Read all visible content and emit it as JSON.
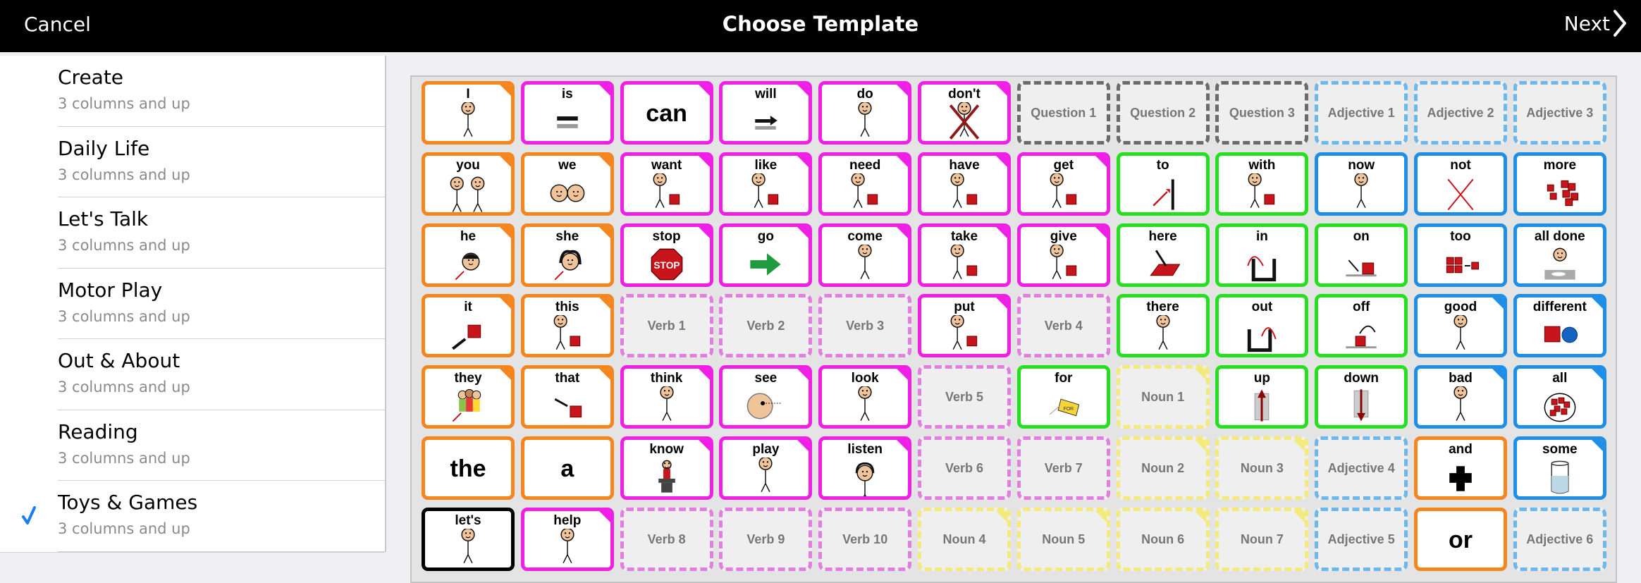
{
  "header": {
    "cancel_label": "Cancel",
    "title": "Choose Template",
    "next_label": "Next"
  },
  "sidebar": {
    "selected_index": 6,
    "items": [
      {
        "title": "Create",
        "subtitle": "3 columns and up"
      },
      {
        "title": "Daily Life",
        "subtitle": "3 columns and up"
      },
      {
        "title": "Let's Talk",
        "subtitle": "3 columns and up"
      },
      {
        "title": "Motor Play",
        "subtitle": "3 columns and up"
      },
      {
        "title": "Out & About",
        "subtitle": "3 columns and up"
      },
      {
        "title": "Reading",
        "subtitle": "3 columns and up"
      },
      {
        "title": "Toys & Games",
        "subtitle": "3 columns and up"
      }
    ]
  },
  "colors": {
    "orange": "#f5851f",
    "pink": "#ef1fe6",
    "green": "#25e01f",
    "blue": "#1e8ee6",
    "black": "#000000",
    "question_placeholder": "#6b6b6b",
    "adjective_placeholder": "#6cb8ec",
    "verb_placeholder": "#e27ee0",
    "noun_placeholder": "#f2ea7a",
    "checkmark": "#1a7ef2"
  },
  "grid": {
    "rows": [
      [
        {
          "label": "I",
          "color": "orange",
          "fold": true,
          "icon": "person-pointing-self-icon"
        },
        {
          "label": "is",
          "color": "pink",
          "fold": true,
          "icon": "equals-icon"
        },
        {
          "label": "can",
          "color": "pink",
          "fold": true,
          "text_only": true
        },
        {
          "label": "will",
          "color": "pink",
          "fold": true,
          "icon": "arrow-equals-icon"
        },
        {
          "label": "do",
          "color": "pink",
          "fold": true,
          "icon": "person-reaching-icon"
        },
        {
          "label": "don't",
          "color": "pink",
          "fold": true,
          "icon": "crossed-person-icon"
        },
        {
          "label": "Question 1",
          "color": "question_placeholder",
          "placeholder": true
        },
        {
          "label": "Question 2",
          "color": "question_placeholder",
          "placeholder": true
        },
        {
          "label": "Question 3",
          "color": "question_placeholder",
          "placeholder": true
        },
        {
          "label": "Adjective 1",
          "color": "adjective_placeholder",
          "placeholder": true
        },
        {
          "label": "Adjective 2",
          "color": "adjective_placeholder",
          "placeholder": true
        },
        {
          "label": "Adjective 3",
          "color": "adjective_placeholder",
          "placeholder": true
        }
      ],
      [
        {
          "label": "you",
          "color": "orange",
          "fold": true,
          "icon": "two-people-pointing-icon"
        },
        {
          "label": "we",
          "color": "orange",
          "fold": true,
          "icon": "two-faces-icon"
        },
        {
          "label": "want",
          "color": "pink",
          "fold": true,
          "icon": "person-reaching-block-icon"
        },
        {
          "label": "like",
          "color": "pink",
          "fold": true,
          "icon": "person-hugging-block-icon"
        },
        {
          "label": "need",
          "color": "pink",
          "fold": true,
          "icon": "hands-block-icon"
        },
        {
          "label": "have",
          "color": "pink",
          "fold": true,
          "icon": "person-holding-block-icon"
        },
        {
          "label": "get",
          "color": "pink",
          "fold": true,
          "icon": "hand-grabbing-block-icon"
        },
        {
          "label": "to",
          "color": "green",
          "fold": false,
          "icon": "arrow-to-line-icon"
        },
        {
          "label": "with",
          "color": "green",
          "fold": false,
          "icon": "block-joining-group-icon"
        },
        {
          "label": "now",
          "color": "blue",
          "fold": false,
          "icon": "person-clock-icon"
        },
        {
          "label": "not",
          "color": "blue",
          "fold": false,
          "icon": "red-x-icon"
        },
        {
          "label": "more",
          "color": "blue",
          "fold": false,
          "icon": "blocks-pile-icon"
        }
      ],
      [
        {
          "label": "he",
          "color": "orange",
          "fold": true,
          "icon": "boy-face-icon"
        },
        {
          "label": "she",
          "color": "orange",
          "fold": true,
          "icon": "girl-face-icon"
        },
        {
          "label": "stop",
          "color": "pink",
          "fold": true,
          "icon": "stop-sign-icon"
        },
        {
          "label": "go",
          "color": "pink",
          "fold": true,
          "icon": "green-arrow-icon"
        },
        {
          "label": "come",
          "color": "pink",
          "fold": true,
          "icon": "person-beckoning-icon"
        },
        {
          "label": "take",
          "color": "pink",
          "fold": true,
          "icon": "person-taking-block-icon"
        },
        {
          "label": "give",
          "color": "pink",
          "fold": true,
          "icon": "people-giving-block-icon"
        },
        {
          "label": "here",
          "color": "green",
          "fold": false,
          "icon": "pointing-at-mat-icon"
        },
        {
          "label": "in",
          "color": "green",
          "fold": false,
          "icon": "arrow-into-box-icon"
        },
        {
          "label": "on",
          "color": "green",
          "fold": false,
          "icon": "arrow-onto-block-icon"
        },
        {
          "label": "too",
          "color": "blue",
          "fold": false,
          "icon": "blocks-adding-icon"
        },
        {
          "label": "all done",
          "color": "blue",
          "fold": false,
          "icon": "person-empty-plate-icon"
        }
      ],
      [
        {
          "label": "it",
          "color": "orange",
          "fold": true,
          "icon": "hand-pointing-block-icon"
        },
        {
          "label": "this",
          "color": "orange",
          "fold": true,
          "icon": "person-pointing-block-icon"
        },
        {
          "label": "Verb 1",
          "color": "verb_placeholder",
          "placeholder": true
        },
        {
          "label": "Verb 2",
          "color": "verb_placeholder",
          "placeholder": true
        },
        {
          "label": "Verb 3",
          "color": "verb_placeholder",
          "placeholder": true
        },
        {
          "label": "put",
          "color": "pink",
          "fold": true,
          "icon": "person-placing-block-icon"
        },
        {
          "label": "Verb 4",
          "color": "verb_placeholder",
          "placeholder": true
        },
        {
          "label": "there",
          "color": "green",
          "fold": false,
          "icon": "person-pointing-sign-icon"
        },
        {
          "label": "out",
          "color": "green",
          "fold": false,
          "icon": "arrow-out-of-box-icon"
        },
        {
          "label": "off",
          "color": "green",
          "fold": false,
          "icon": "arrow-off-block-icon"
        },
        {
          "label": "good",
          "color": "blue",
          "fold": true,
          "icon": "person-thumbs-up-icon"
        },
        {
          "label": "different",
          "color": "blue",
          "fold": true,
          "icon": "square-and-circle-icon"
        }
      ],
      [
        {
          "label": "they",
          "color": "orange",
          "fold": true,
          "icon": "group-of-people-icon"
        },
        {
          "label": "that",
          "color": "orange",
          "fold": true,
          "icon": "hand-pointing-far-block-icon"
        },
        {
          "label": "think",
          "color": "pink",
          "fold": true,
          "icon": "person-thinking-icon"
        },
        {
          "label": "see",
          "color": "pink",
          "fold": true,
          "icon": "eye-looking-icon"
        },
        {
          "label": "look",
          "color": "pink",
          "fold": true,
          "icon": "person-looking-icon"
        },
        {
          "label": "Verb 5",
          "color": "verb_placeholder",
          "placeholder": true
        },
        {
          "label": "for",
          "color": "green",
          "fold": false,
          "icon": "price-tag-icon"
        },
        {
          "label": "Noun 1",
          "color": "noun_placeholder",
          "placeholder": true,
          "fold": true
        },
        {
          "label": "up",
          "color": "green",
          "fold": false,
          "icon": "arrow-up-icon"
        },
        {
          "label": "down",
          "color": "green",
          "fold": false,
          "icon": "arrow-down-icon"
        },
        {
          "label": "bad",
          "color": "blue",
          "fold": true,
          "icon": "person-thumbs-down-icon"
        },
        {
          "label": "all",
          "color": "blue",
          "fold": true,
          "icon": "bag-of-blocks-icon"
        }
      ],
      [
        {
          "label": "the",
          "color": "orange",
          "fold": false,
          "text_only": true
        },
        {
          "label": "a",
          "color": "orange",
          "fold": false,
          "text_only": true
        },
        {
          "label": "know",
          "color": "pink",
          "fold": true,
          "icon": "person-at-desk-icon"
        },
        {
          "label": "play",
          "color": "pink",
          "fold": true,
          "icon": "people-playing-icon"
        },
        {
          "label": "listen",
          "color": "pink",
          "fold": true,
          "icon": "person-headphones-icon"
        },
        {
          "label": "Verb 6",
          "color": "verb_placeholder",
          "placeholder": true
        },
        {
          "label": "Verb 7",
          "color": "verb_placeholder",
          "placeholder": true
        },
        {
          "label": "Noun 2",
          "color": "noun_placeholder",
          "placeholder": true,
          "fold": true
        },
        {
          "label": "Noun 3",
          "color": "noun_placeholder",
          "placeholder": true,
          "fold": true
        },
        {
          "label": "Adjective 4",
          "color": "adjective_placeholder",
          "placeholder": true
        },
        {
          "label": "and",
          "color": "orange",
          "fold": false,
          "icon": "plus-sign-icon"
        },
        {
          "label": "some",
          "color": "blue",
          "fold": true,
          "icon": "glass-of-water-icon"
        }
      ],
      [
        {
          "label": "let's",
          "color": "black",
          "fold": false,
          "icon": "people-together-icon"
        },
        {
          "label": "help",
          "color": "pink",
          "fold": true,
          "icon": "person-helping-icon"
        },
        {
          "label": "Verb 8",
          "color": "verb_placeholder",
          "placeholder": true
        },
        {
          "label": "Verb 9",
          "color": "verb_placeholder",
          "placeholder": true
        },
        {
          "label": "Verb 10",
          "color": "verb_placeholder",
          "placeholder": true
        },
        {
          "label": "Noun 4",
          "color": "noun_placeholder",
          "placeholder": true,
          "fold": true
        },
        {
          "label": "Noun 5",
          "color": "noun_placeholder",
          "placeholder": true,
          "fold": true
        },
        {
          "label": "Noun 6",
          "color": "noun_placeholder",
          "placeholder": true,
          "fold": true
        },
        {
          "label": "Noun 7",
          "color": "noun_placeholder",
          "placeholder": true,
          "fold": true
        },
        {
          "label": "Adjective 5",
          "color": "adjective_placeholder",
          "placeholder": true
        },
        {
          "label": "or",
          "color": "orange",
          "fold": false,
          "text_only": true
        },
        {
          "label": "Adjective 6",
          "color": "adjective_placeholder",
          "placeholder": true
        }
      ]
    ]
  }
}
